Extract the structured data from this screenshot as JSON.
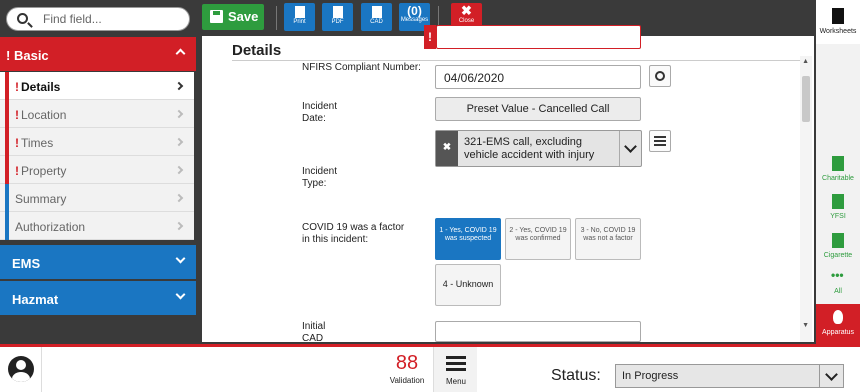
{
  "search": {
    "placeholder": "Find field..."
  },
  "sidebar": {
    "basic": {
      "flag": "!",
      "label": "Basic"
    },
    "items": [
      {
        "label": "Details",
        "flag": "!"
      },
      {
        "label": "Location",
        "flag": "!"
      },
      {
        "label": "Times",
        "flag": "!"
      },
      {
        "label": "Property",
        "flag": "!"
      },
      {
        "label": "Summary",
        "flag": ""
      },
      {
        "label": "Authorization",
        "flag": ""
      }
    ],
    "ems": "EMS",
    "hazmat": "Hazmat"
  },
  "toolbar": {
    "save": "Save",
    "print": "Print",
    "pdf": "PDF",
    "cad": "CAD",
    "messages_count": "(0)",
    "messages": "Messages",
    "close": "Close"
  },
  "main": {
    "title": "Details",
    "nfirs_label": "NFIRS Compliant Number:",
    "required_flag": "!",
    "incident_date_label": "Incident Date:",
    "incident_date_value": "04/06/2020",
    "preset_button": "Preset Value - Cancelled Call",
    "incident_type_label": "Incident Type:",
    "incident_type_value": "321-EMS call, excluding vehicle accident with injury",
    "clear_glyph": "✖",
    "covid_label": "COVID 19 was a factor in this incident:",
    "covid_options": [
      "1 - Yes, COVID 19 was suspected",
      "2 - Yes, COVID 19 was confirmed",
      "3 - No, COVID 19 was not a factor",
      "4 - Unknown"
    ],
    "covid_selected": 0,
    "cad_label": "Initial CAD Incident"
  },
  "rail": {
    "worksheets": "Worksheets",
    "charitable": "Charitable",
    "yfsi": "YFSI",
    "cigarette": "Cigarette",
    "all": "All",
    "apparatus": "Apparatus"
  },
  "footer": {
    "validation_count": "88",
    "validation_label": "Validation",
    "menu_label": "Menu",
    "status_label": "Status:",
    "status_value": "In Progress"
  },
  "colors": {
    "accent_red": "#d21f26",
    "accent_blue": "#1a76c2",
    "accent_green": "#2e9c3e"
  }
}
